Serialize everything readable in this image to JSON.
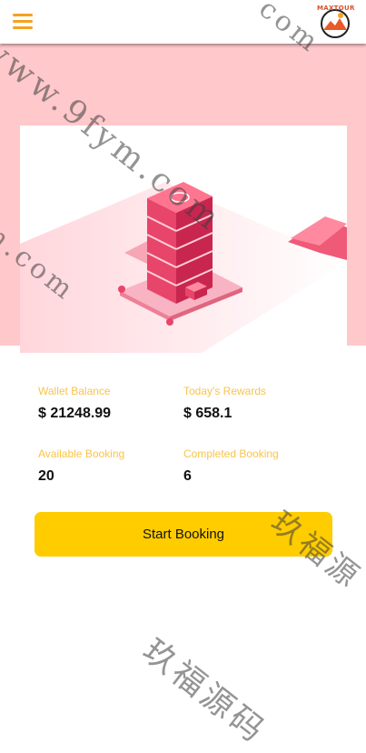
{
  "header": {
    "menu_icon": "hamburger-menu-icon",
    "logo_text": "MAXTOUR",
    "accent_color": "#f6a21e"
  },
  "banner": {
    "background_color": "#ffc8cb",
    "illustration": "isometric-server-tower-illustration"
  },
  "stats": [
    {
      "label": "Wallet Balance",
      "value": "$ 21248.99"
    },
    {
      "label": "Today's Rewards",
      "value": "$ 658.1"
    },
    {
      "label": "Available Booking",
      "value": "20"
    },
    {
      "label": "Completed Booking",
      "value": "6"
    }
  ],
  "actions": {
    "start_booking_label": "Start Booking",
    "button_color": "#ffcc00"
  },
  "watermarks": {
    "url_text_1": "www.9fym.com",
    "url_text_2": "m.com",
    "url_text_3": "com",
    "cjk_text_1": "玖福源",
    "cjk_text_2": "玖福源码"
  }
}
